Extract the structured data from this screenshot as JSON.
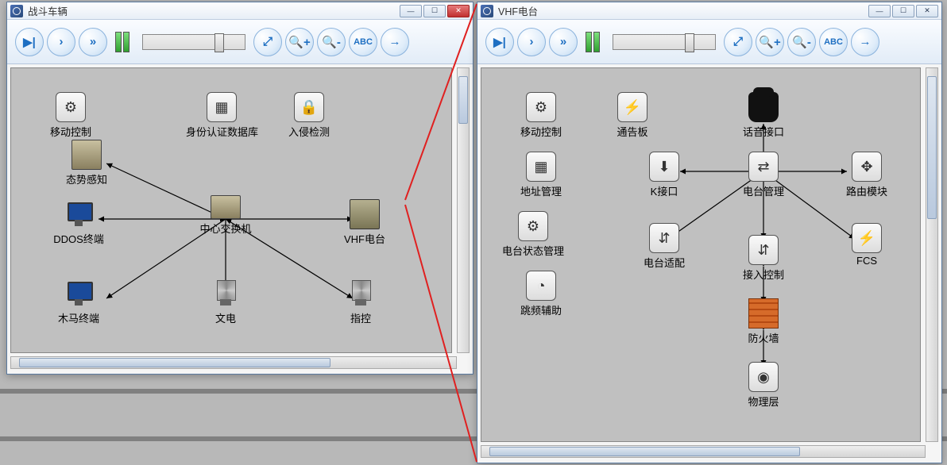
{
  "windows": [
    {
      "id": "w1",
      "title": "战斗车辆",
      "toolbar": {
        "abc": "ABC"
      },
      "nodes": {
        "mobile_ctrl": "移动控制",
        "auth_db": "身份认证数据库",
        "intrusion": "入侵检测",
        "sit_aware": "态势感知",
        "ddos": "DDOS终端",
        "trojan": "木马终端",
        "switch": "中心交换机",
        "doc": "文电",
        "cmd": "指控",
        "vhf": "VHF电台"
      }
    },
    {
      "id": "w2",
      "title": "VHF电台",
      "toolbar": {
        "abc": "ABC"
      },
      "nodes": {
        "mobile_ctrl": "移动控制",
        "bulletin": "通告板",
        "voice": "话音接口",
        "addr": "地址管理",
        "k_if": "K接口",
        "radio_mgr": "电台管理",
        "route": "路由模块",
        "status_mgr": "电台状态管理",
        "adapter": "电台适配",
        "access": "接入控制",
        "fcs": "FCS",
        "hop": "跳频辅助",
        "firewall": "防火墙",
        "phy": "物理层"
      }
    }
  ]
}
